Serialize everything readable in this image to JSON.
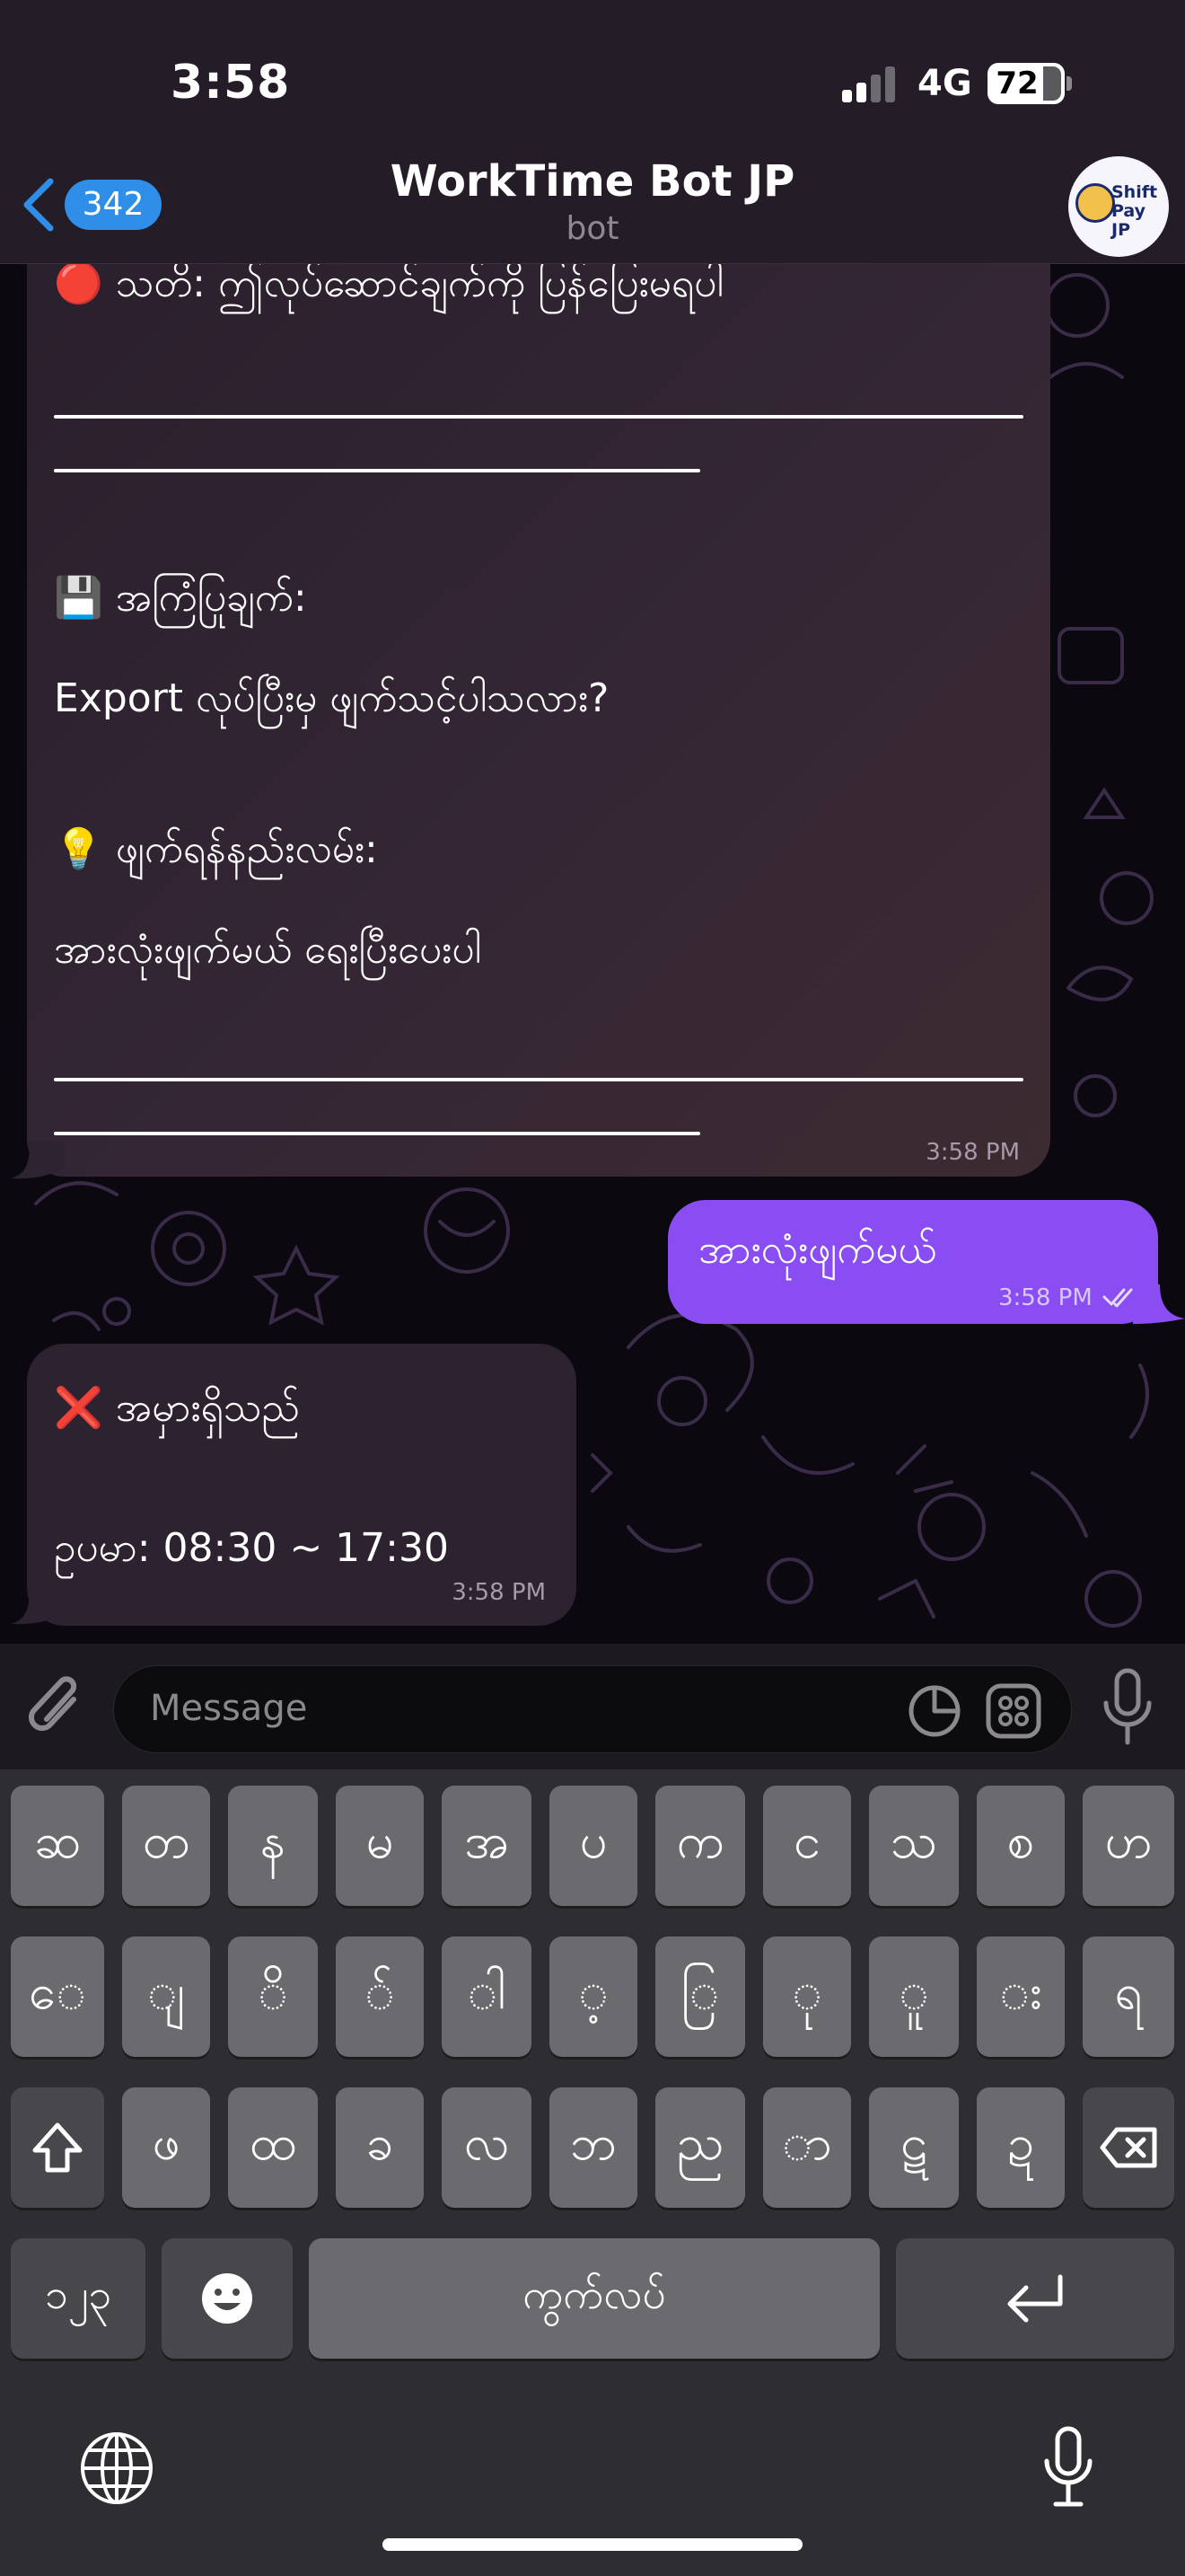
{
  "status_bar": {
    "time": "3:58",
    "network": "4G",
    "battery_level": "72",
    "icons": [
      "cellular-signal-icon",
      "battery-icon"
    ]
  },
  "header": {
    "back_badge": "342",
    "title": "WorkTime Bot JP",
    "subtitle": "bot",
    "avatar_text_line1": "Shift",
    "avatar_text_line2": "Pay JP"
  },
  "messages": {
    "bot_message_1": {
      "warning_line": "🔴 သတိ: ဤလုပ်ဆောင်ချက်ကို ပြန်ပြေးမရပါ",
      "advice_heading": "💾 အကြံပြုချက်:",
      "advice_text": "Export လုပ်ပြီးမှ ဖျက်သင့်ပါသလား?",
      "method_heading": "💡 ဖျက်ရန်နည်းလမ်း:",
      "method_text": "အားလုံးဖျက်မယ် ရေးပြီးပေးပါ",
      "time": "3:58 PM"
    },
    "user_message": {
      "text": "အားလုံးဖျက်မယ်",
      "time": "3:58 PM"
    },
    "bot_message_2": {
      "error_heading": "❌ အမှားရှိသည်",
      "example_text": "ဥပမာ: 08:30 ~ 17:30",
      "time": "3:58 PM"
    }
  },
  "composer": {
    "placeholder": "Message"
  },
  "keyboard": {
    "row1": [
      "ဆ",
      "တ",
      "န",
      "မ",
      "အ",
      "ပ",
      "က",
      "င",
      "သ",
      "စ",
      "ဟ"
    ],
    "row2": [
      "ေ",
      "ျ",
      "ိ",
      "်",
      "ါ",
      "့",
      "ြ",
      "ု",
      "ူ",
      "း",
      "ရ"
    ],
    "row3": [
      "ဖ",
      "ထ",
      "ခ",
      "လ",
      "ဘ",
      "ည",
      "ာ",
      "ဋ",
      "ဍ"
    ],
    "numbers_key": "၁၂၃",
    "space_key": "ကွက်လပ်"
  },
  "colors": {
    "outgoing_bubble": "#8a4df2",
    "incoming_bubble": "#2c2230",
    "badge": "#2f8ee8"
  }
}
